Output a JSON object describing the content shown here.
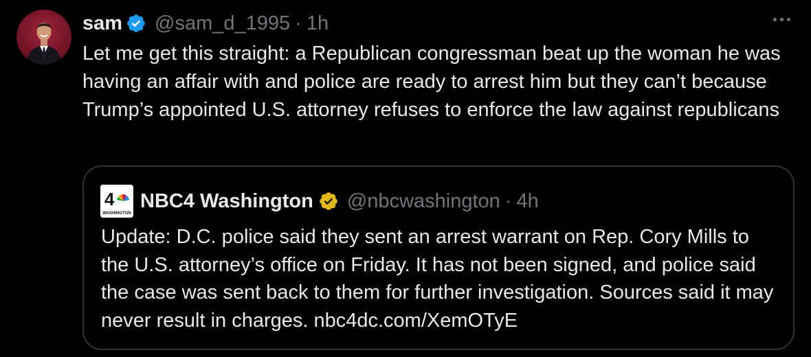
{
  "tweet": {
    "author_name": "sam",
    "author_handle": "@sam_d_1995",
    "separator": "·",
    "time": "1h",
    "text": "Let me get this straight: a Republican congressman beat up the woman he was having an affair with and police are ready to arrest him but they can’t because Trump’s appointed U.S. attorney refuses to enforce the law against republicans",
    "verified_badge_icon": "blue-verified-check-icon",
    "more_icon": "more-options-icon"
  },
  "quote": {
    "author_name": "NBC4 Washington",
    "author_handle": "@nbcwashington",
    "separator": "·",
    "time": "4h",
    "logo_text": "4",
    "logo_subtext": "WASHINGTON",
    "text": "Update: D.C. police said they sent an arrest warrant on Rep. Cory Mills to the U.S. attorney’s office on Friday. It has not been signed, and police said the case was sent back to them for further investigation. Sources said it may never result in charges. nbc4dc.com/XemOTyE",
    "verified_badge_icon": "gold-verified-check-icon"
  },
  "colors": {
    "background": "#000000",
    "text_primary": "#e7e9ea",
    "text_secondary": "#71767b",
    "border": "#2f3336",
    "blue_badge": "#1d9bf0",
    "gold_badge": "#e2b719"
  }
}
